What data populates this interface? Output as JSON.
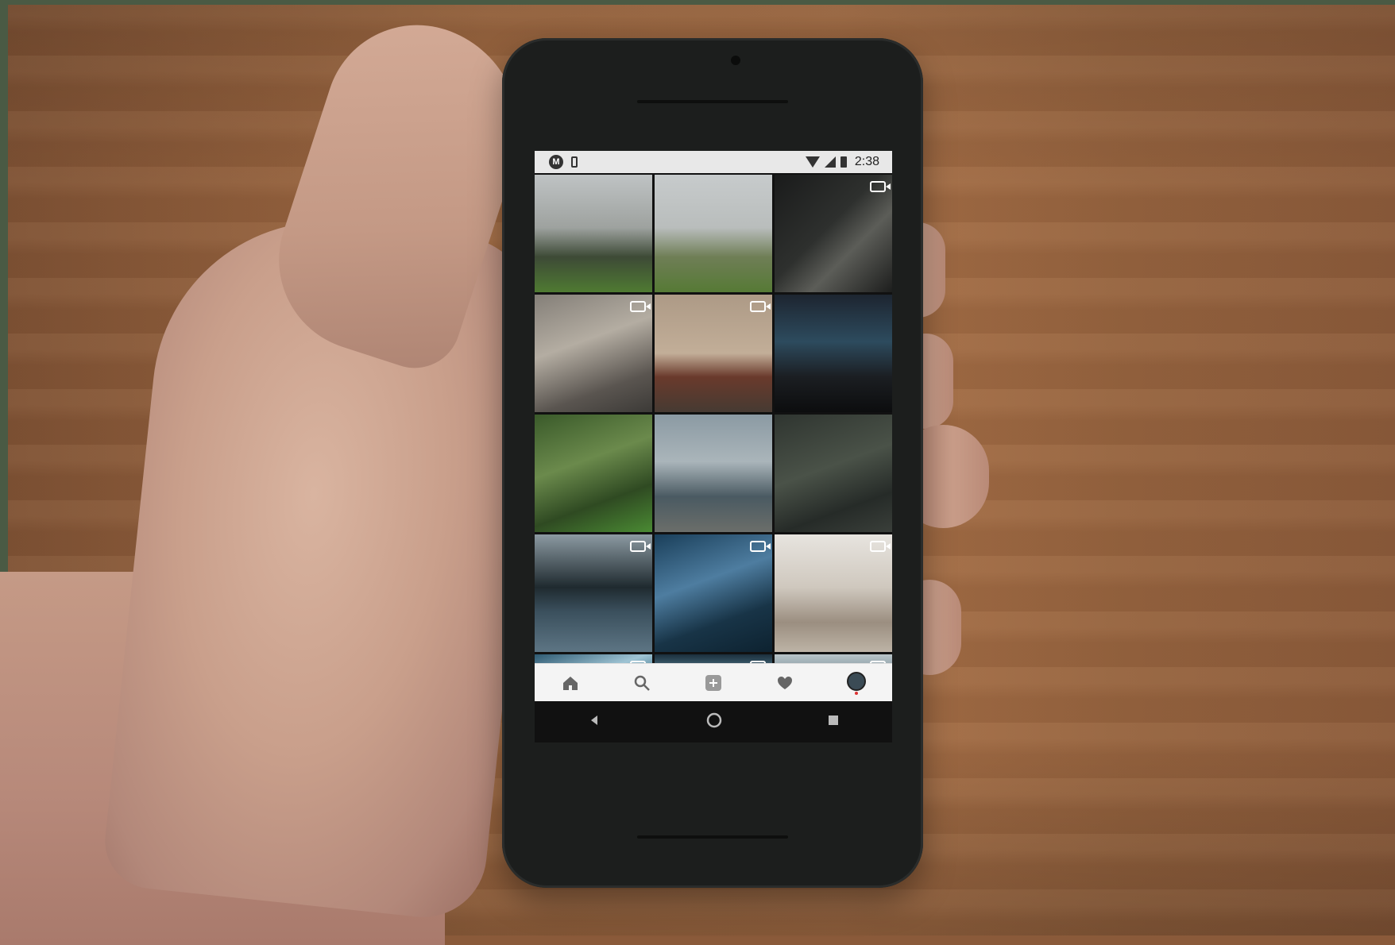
{
  "status_bar": {
    "app_badge": "M",
    "time": "2:38",
    "icons": [
      "app-notification-icon",
      "phone-notification-icon",
      "wifi-icon",
      "signal-icon",
      "battery-icon"
    ]
  },
  "grid": {
    "tiles": [
      {
        "name": "tile-camera-rig",
        "video": false
      },
      {
        "name": "tile-man-shouting",
        "video": false
      },
      {
        "name": "tile-driver-sunglasses",
        "video": true
      },
      {
        "name": "tile-car-interior",
        "video": true
      },
      {
        "name": "tile-red-car",
        "video": true
      },
      {
        "name": "tile-editing-screen",
        "video": false
      },
      {
        "name": "tile-cameraman-jungle",
        "video": false
      },
      {
        "name": "tile-car-roof",
        "video": false
      },
      {
        "name": "tile-hiker-rocks",
        "video": false
      },
      {
        "name": "tile-coastline",
        "video": true
      },
      {
        "name": "tile-underwater",
        "video": true
      },
      {
        "name": "tile-surfer-board",
        "video": true
      },
      {
        "name": "tile-wave-1",
        "video": true
      },
      {
        "name": "tile-wave-2",
        "video": true
      },
      {
        "name": "tile-beach-figure",
        "video": true
      }
    ]
  },
  "bottom_nav": {
    "items": [
      "home-icon",
      "search-icon",
      "add-post-icon",
      "heart-icon",
      "profile-avatar"
    ]
  },
  "system_nav": {
    "items": [
      "back-icon",
      "home-circle-icon",
      "recents-icon"
    ]
  }
}
